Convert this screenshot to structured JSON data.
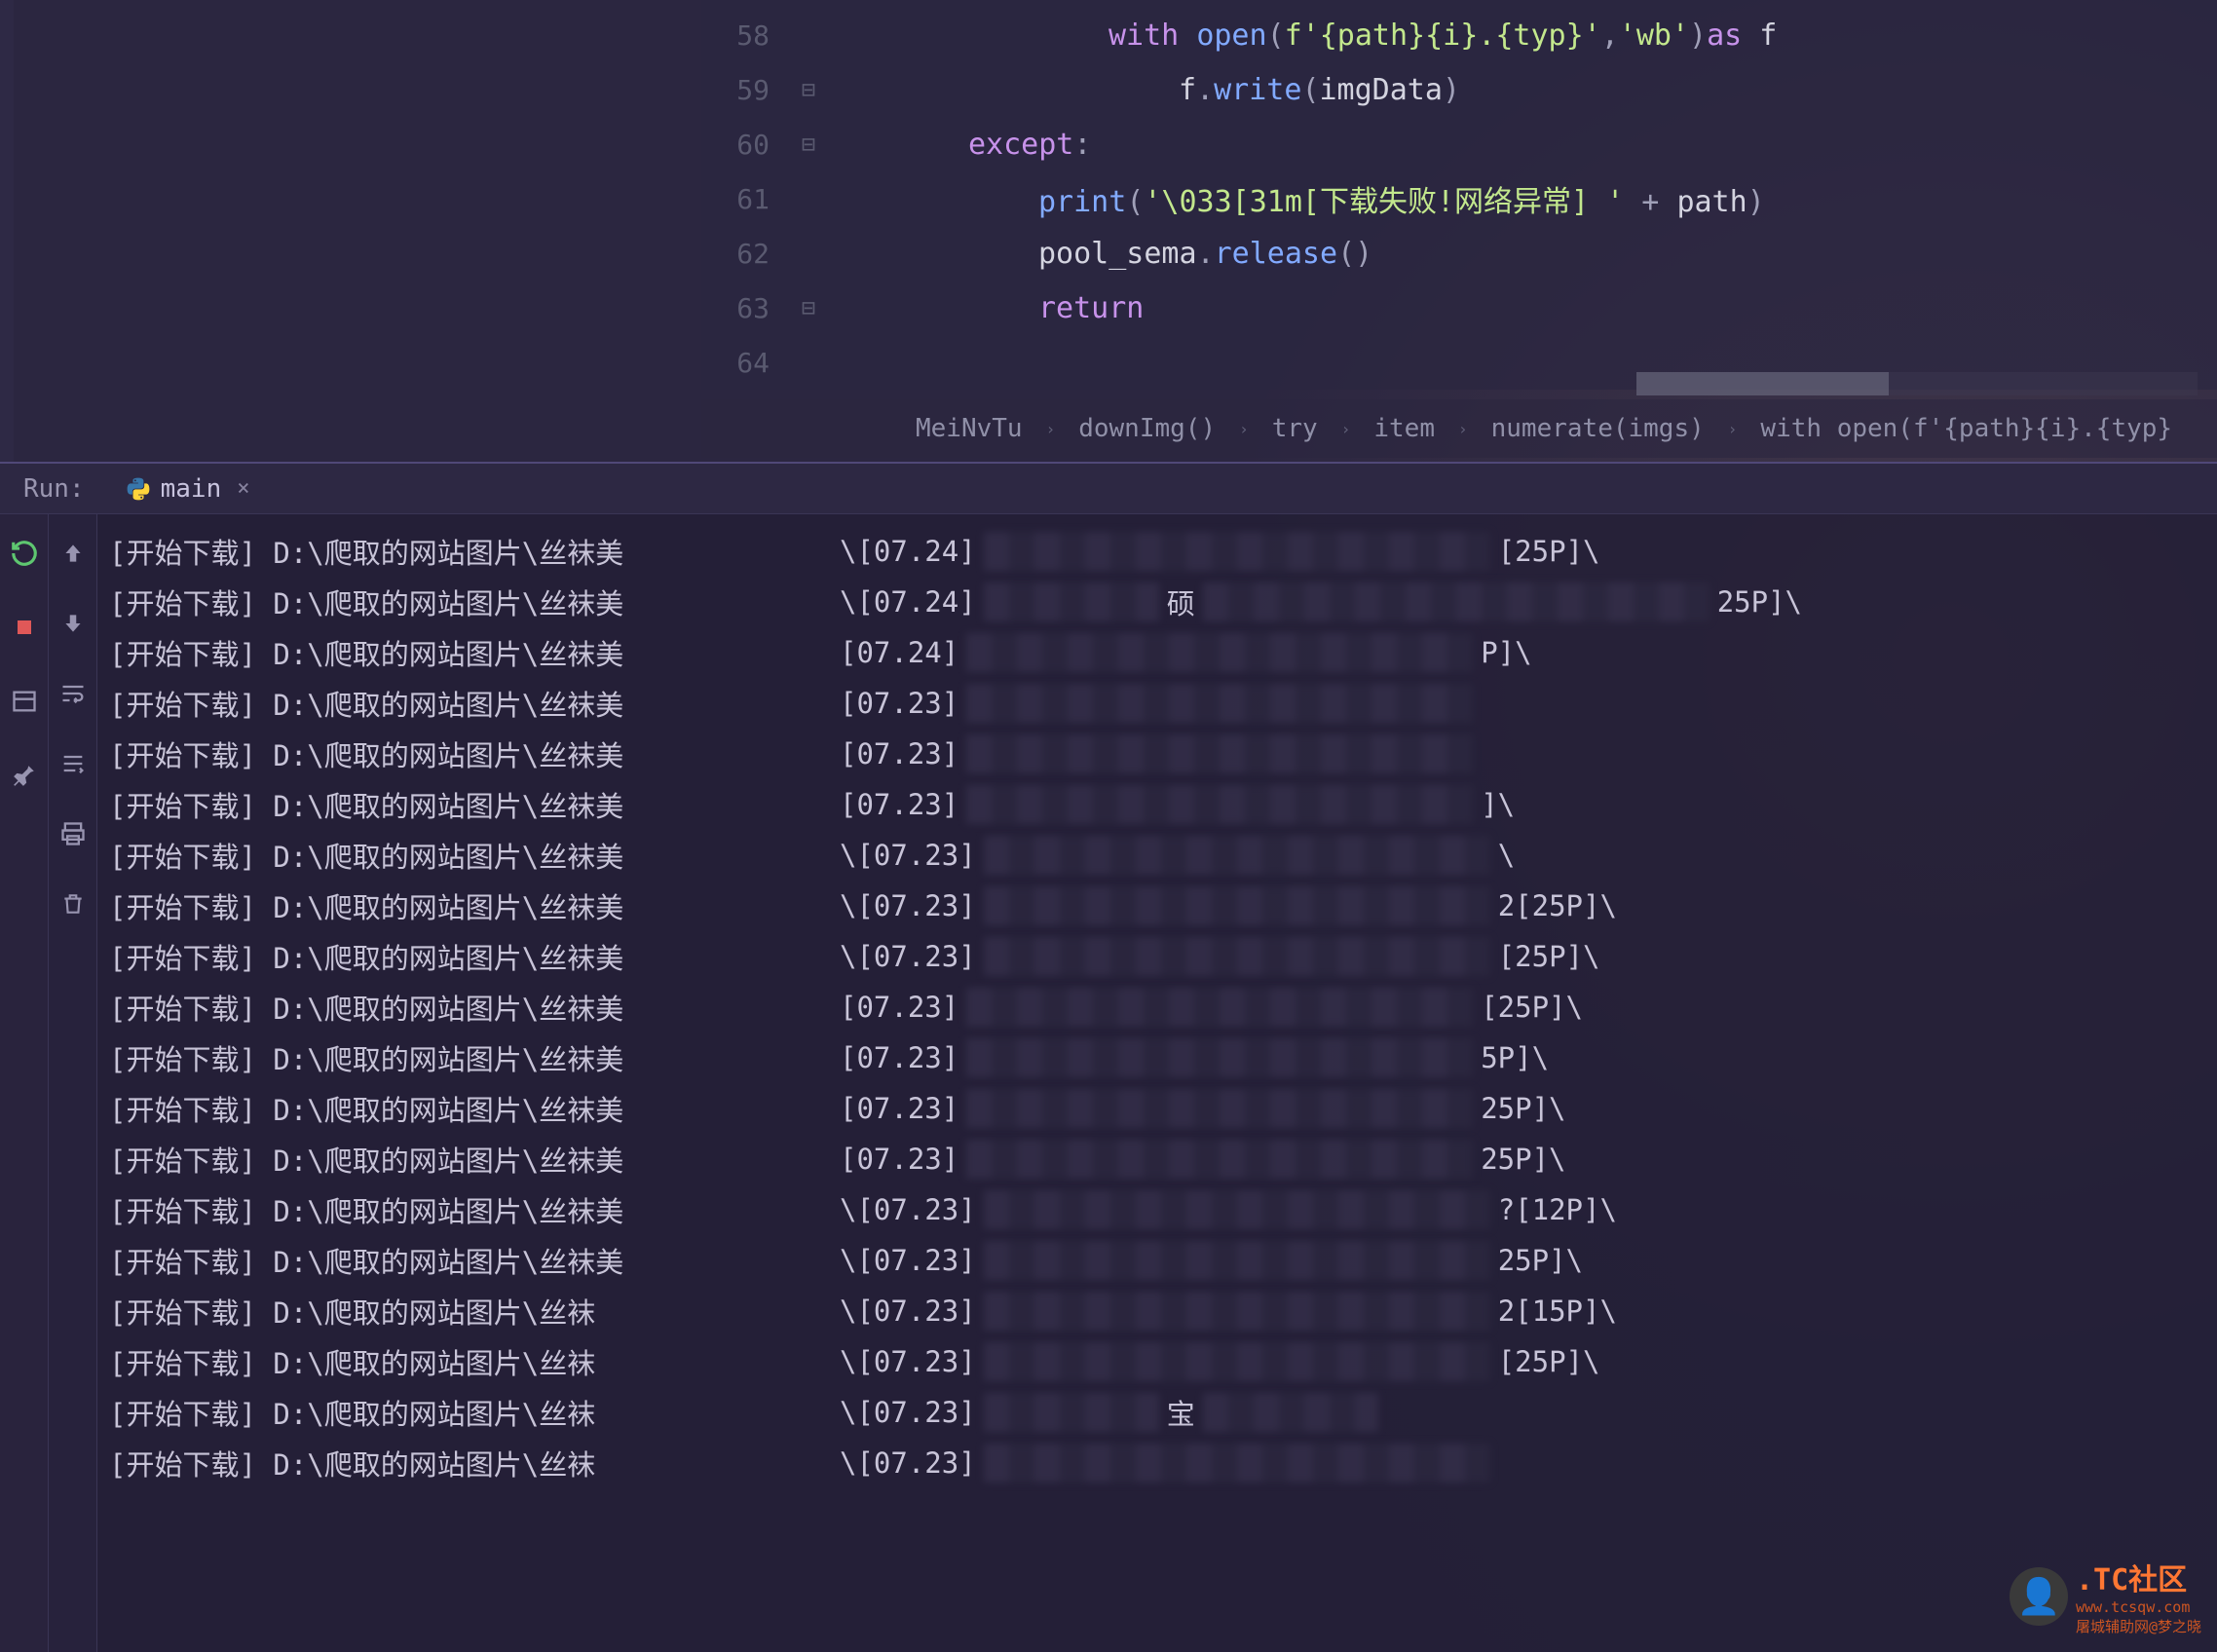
{
  "code": {
    "lines": [
      {
        "num": "58",
        "fold": "",
        "indent": 16,
        "tokens": [
          {
            "cls": "kw-with",
            "t": "with "
          },
          {
            "cls": "kw-fn",
            "t": "open"
          },
          {
            "cls": "punct",
            "t": "("
          },
          {
            "cls": "str",
            "t": "f'{path}{i}.{typ}'"
          },
          {
            "cls": "punct",
            "t": ","
          },
          {
            "cls": "str",
            "t": "'wb'"
          },
          {
            "cls": "punct",
            "t": ")"
          },
          {
            "cls": "kw-with",
            "t": "as "
          },
          {
            "cls": "ident",
            "t": "f"
          }
        ]
      },
      {
        "num": "59",
        "fold": "⊟",
        "indent": 20,
        "tokens": [
          {
            "cls": "ident",
            "t": "f"
          },
          {
            "cls": "punct",
            "t": "."
          },
          {
            "cls": "kw-fn",
            "t": "write"
          },
          {
            "cls": "punct",
            "t": "("
          },
          {
            "cls": "ident",
            "t": "imgData"
          },
          {
            "cls": "punct",
            "t": ")"
          }
        ]
      },
      {
        "num": "60",
        "fold": "⊟",
        "indent": 8,
        "tokens": [
          {
            "cls": "kw-except",
            "t": "except"
          },
          {
            "cls": "punct",
            "t": ":"
          }
        ]
      },
      {
        "num": "61",
        "fold": "",
        "indent": 12,
        "tokens": [
          {
            "cls": "kw-fn",
            "t": "print"
          },
          {
            "cls": "punct",
            "t": "("
          },
          {
            "cls": "str",
            "t": "'\\033[31m[下载失败!网络异常] '"
          },
          {
            "cls": "punct",
            "t": " + "
          },
          {
            "cls": "ident",
            "t": "path"
          },
          {
            "cls": "punct",
            "t": ")"
          }
        ]
      },
      {
        "num": "62",
        "fold": "",
        "indent": 12,
        "tokens": [
          {
            "cls": "ident",
            "t": "pool_sema"
          },
          {
            "cls": "punct",
            "t": "."
          },
          {
            "cls": "kw-fn",
            "t": "release"
          },
          {
            "cls": "punct",
            "t": "()"
          }
        ]
      },
      {
        "num": "63",
        "fold": "⊟",
        "indent": 12,
        "tokens": [
          {
            "cls": "kw-return",
            "t": "return"
          }
        ]
      },
      {
        "num": "64",
        "fold": "",
        "indent": 0,
        "tokens": []
      }
    ]
  },
  "breadcrumbs": [
    "MeiNvTu",
    "downImg()",
    "try",
    "item",
    "numerate(imgs)",
    "with open(f'{path}{i}.{typ}"
  ],
  "run": {
    "label": "Run:",
    "tab_name": "main",
    "tab_close": "×"
  },
  "console": [
    {
      "left": "[开始下载] D:\\爬取的网站图片\\丝袜美",
      "mid": "\\[07.24]",
      "px": "mid",
      "right": "[25P]\\"
    },
    {
      "left": "[开始下载] D:\\爬取的网站图片\\丝袜美",
      "mid": "\\[07.24]",
      "px": "mid",
      "midchar": "硕",
      "right": "25P]\\"
    },
    {
      "left": "[开始下载] D:\\爬取的网站图片\\丝袜美",
      "mid": "[07.24]",
      "px": "mid",
      "right": "P]\\"
    },
    {
      "left": "[开始下载] D:\\爬取的网站图片\\丝袜美",
      "mid": "[07.23]",
      "px": "mid",
      "right": ""
    },
    {
      "left": "[开始下载] D:\\爬取的网站图片\\丝袜美",
      "mid": "[07.23]",
      "px": "mid",
      "right": ""
    },
    {
      "left": "[开始下载] D:\\爬取的网站图片\\丝袜美",
      "mid": "[07.23]",
      "px": "mid",
      "right": "]\\"
    },
    {
      "left": "[开始下载] D:\\爬取的网站图片\\丝袜美",
      "mid": "\\[07.23]",
      "px": "mid",
      "right": "\\"
    },
    {
      "left": "[开始下载] D:\\爬取的网站图片\\丝袜美",
      "mid": "\\[07.23]",
      "px": "mid",
      "right": "2[25P]\\"
    },
    {
      "left": "[开始下载] D:\\爬取的网站图片\\丝袜美",
      "mid": "\\[07.23]",
      "px": "mid",
      "right": "[25P]\\"
    },
    {
      "left": "[开始下载] D:\\爬取的网站图片\\丝袜美",
      "mid": "[07.23]",
      "px": "mid",
      "right": "[25P]\\"
    },
    {
      "left": "[开始下载] D:\\爬取的网站图片\\丝袜美",
      "mid": "[07.23]",
      "px": "mid",
      "right": "5P]\\"
    },
    {
      "left": "[开始下载] D:\\爬取的网站图片\\丝袜美",
      "mid": "[07.23]",
      "px": "mid",
      "right": "25P]\\"
    },
    {
      "left": "[开始下载] D:\\爬取的网站图片\\丝袜美",
      "mid": "[07.23]",
      "px": "mid",
      "right": "25P]\\"
    },
    {
      "left": "[开始下载] D:\\爬取的网站图片\\丝袜美",
      "mid": "\\[07.23]",
      "px": "mid",
      "right": "?[12P]\\"
    },
    {
      "left": "[开始下载] D:\\爬取的网站图片\\丝袜美",
      "mid": "\\[07.23]",
      "px": "mid",
      "right": "25P]\\"
    },
    {
      "left": "[开始下载] D:\\爬取的网站图片\\丝袜",
      "mid": "\\[07.23]",
      "px": "mid",
      "right": "2[15P]\\"
    },
    {
      "left": "[开始下载] D:\\爬取的网站图片\\丝袜",
      "mid": "\\[07.23]",
      "px": "mid",
      "right": "[25P]\\"
    },
    {
      "left": "[开始下载] D:\\爬取的网站图片\\丝袜",
      "mid": "\\[07.23]",
      "px": "tiny",
      "midchar": "宝",
      "right": ""
    },
    {
      "left": "[开始下载] D:\\爬取的网站图片\\丝袜",
      "mid": "\\[07.23]",
      "px": "mid",
      "right": ""
    }
  ],
  "watermark": {
    "tc": ".TC社区",
    "sub": "屠城辅助网@梦之晓",
    "url": "www.tcsqw.com"
  }
}
